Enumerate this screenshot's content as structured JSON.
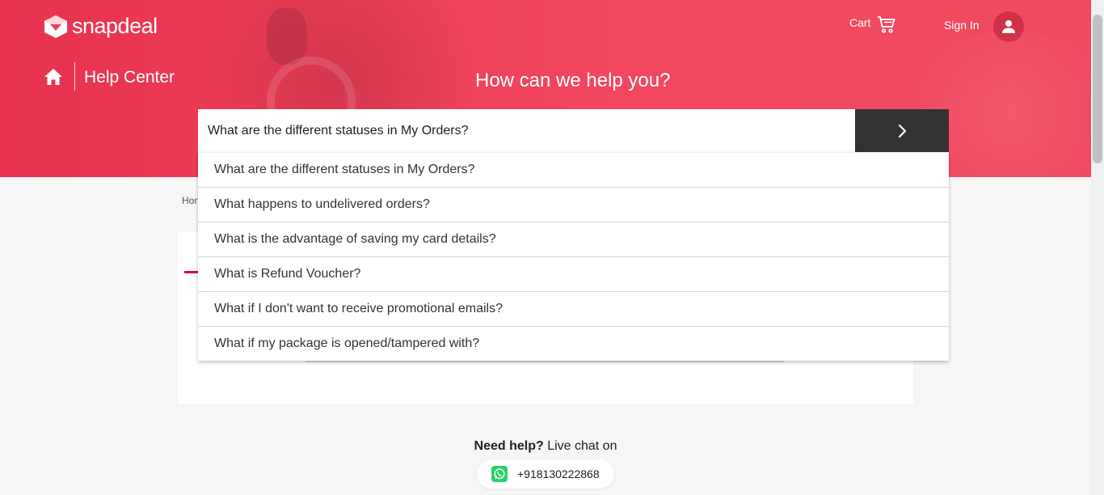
{
  "brand": {
    "name": "snapdeal"
  },
  "header": {
    "cart_label": "Cart",
    "signin_label": "Sign In",
    "section_title": "Help Center",
    "hero_title": "How can we help you?"
  },
  "search": {
    "value": "What are the different statuses in My Orders?",
    "suggestions": [
      "What are the different statuses in My Orders?",
      "What happens to undelivered orders?",
      "What is the advantage of saving my card details?",
      "What is Refund Voucher?",
      "What if I don't want to receive promotional emails?",
      "What if my package is opened/tampered with?"
    ]
  },
  "breadcrumb": {
    "partial": "Hon"
  },
  "footer": {
    "need_help_bold": "Need help?",
    "need_help_rest": " Live chat on",
    "phone": "+918130222868"
  },
  "colors": {
    "brand_red": "#e8324f",
    "button_dark": "#333333",
    "whatsapp_green": "#25d366"
  },
  "icons": [
    "snapdeal-logo-icon",
    "cart-icon",
    "user-icon",
    "home-icon",
    "chevron-right-icon",
    "whatsapp-icon"
  ]
}
